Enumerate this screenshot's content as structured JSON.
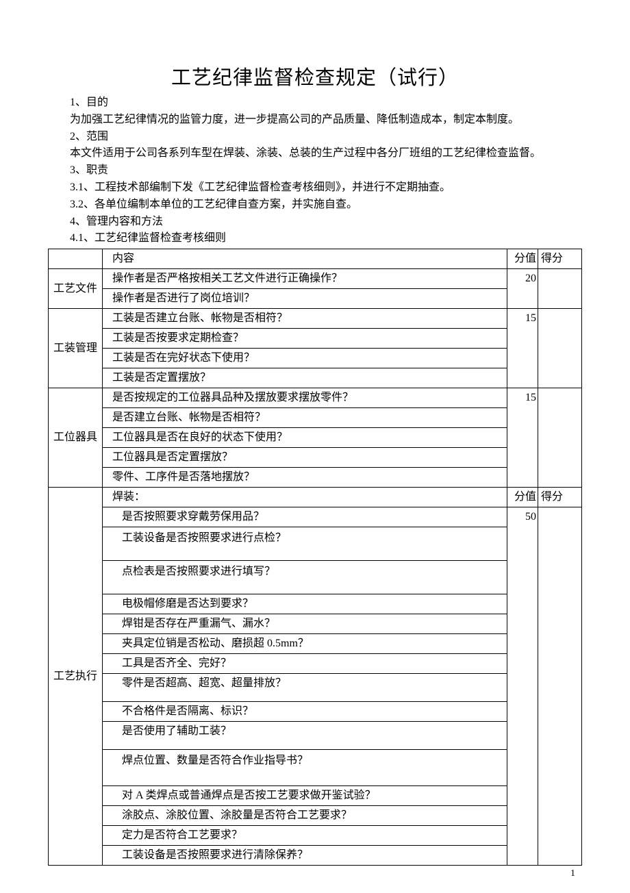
{
  "title": "工艺纪律监督检查规定（试行）",
  "paragraphs": {
    "p1h": "1、目的",
    "p1": "为加强工艺纪律情况的监管力度，进一步提高公司的产品质量、降低制造成本，制定本制度。",
    "p2h": "2、范围",
    "p2": "本文件适用于公司各系列车型在焊装、涂装、总装的生产过程中各分厂班组的工艺纪律检查监督。",
    "p3h": "3、职责",
    "p3a": "3.1、工程技术部编制下发《工艺纪律监督检查考核细则》，并进行不定期抽查。",
    "p3b": "3.2、各单位编制本单位的工艺纪律自查方案，并实施自查。",
    "p4h": "4、管理内容和方法",
    "p4a": "4.1、工艺纪律监督检查考核细则"
  },
  "headers": {
    "content": "内容",
    "value": "分值",
    "score": "得分"
  },
  "categories": {
    "cat1": "工艺文件",
    "cat2": "工装管理",
    "cat3": "工位器具",
    "cat4": "工艺执行"
  },
  "values": {
    "v1": "20",
    "v2": "15",
    "v3": "15",
    "v4": "50"
  },
  "rows": {
    "r1a": "操作者是否严格按相关工艺文件进行正确操作？",
    "r1b": "操作者是否进行了岗位培训？",
    "r2a": "工装是否建立台账、帐物是否相符？",
    "r2b": "工装是否按要求定期检查？",
    "r2c": "工装是否在完好状态下使用？",
    "r2d": "工装是否定置摆放？",
    "r3a": "是否按规定的工位器具品种及摆放要求摆放零件？",
    "r3b": "是否建立台账、帐物是否相符？",
    "r3c": "工位器具是否在良好的状态下使用？",
    "r3d": "工位器具是否定置摆放？",
    "r3e": "零件、工序件是否落地摆放？",
    "r4hdr": "焊装：",
    "r4a": "是否按照要求穿戴劳保用品？",
    "r4b": "工装设备是否按照要求进行点检？",
    "r4c": "点检表是否按照要求进行填写？",
    "r4d": "电极帽修磨是否达到要求？",
    "r4e": "焊钳是否存在严重漏气、漏水？",
    "r4f": "夹具定位销是否松动、磨损超 0.5mm？",
    "r4g": "工具是否齐全、完好？",
    "r4h": "零件是否超高、超宽、超量排放？",
    "r4i": "不合格件是否隔离、标识？",
    "r4j": "是否使用了辅助工装？",
    "r4k": "焊点位置、数量是否符合作业指导书？",
    "r4l": "对 A 类焊点或普通焊点是否按工艺要求做开鉴试验？",
    "r4m": "涂胶点、涂胶位置、涂胶量是否符合工艺要求？",
    "r4n": "定力是否符合工艺要求？",
    "r4o": "工装设备是否按照要求进行清除保养？"
  },
  "pagenum": "1"
}
